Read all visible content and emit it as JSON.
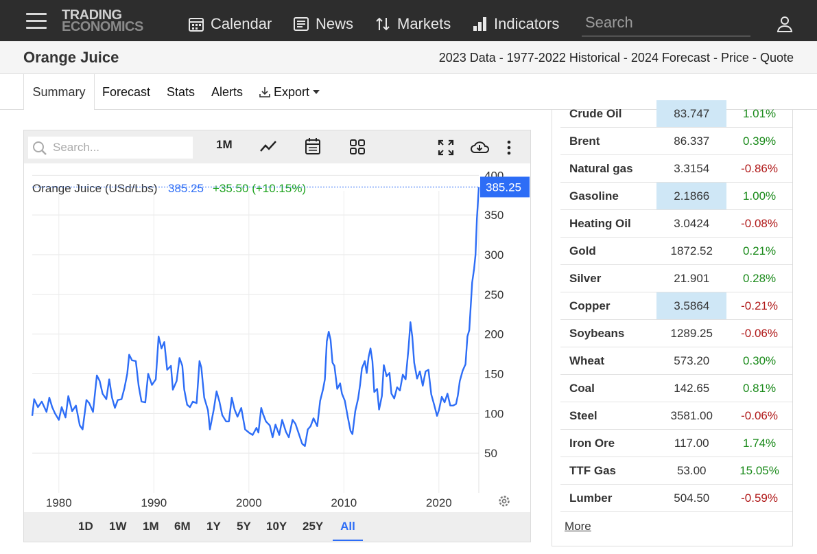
{
  "brand": {
    "line1": "TRADING",
    "line2": "ECONOMICS"
  },
  "nav": {
    "calendar": "Calendar",
    "news": "News",
    "markets": "Markets",
    "indicators": "Indicators",
    "search_placeholder": "Search"
  },
  "page": {
    "title": "Orange Juice",
    "crumbs": [
      {
        "label": "2023 Data"
      },
      {
        "label": "1977-2022 Historical"
      },
      {
        "label": "2024 Forecast"
      },
      {
        "label": "Price"
      },
      {
        "label": "Quote"
      }
    ],
    "crumb_separator": " - "
  },
  "tabs": {
    "summary": "Summary",
    "forecast": "Forecast",
    "stats": "Stats",
    "alerts": "Alerts",
    "export": "Export"
  },
  "chart_toolbar": {
    "search_placeholder": "Search...",
    "range_label": "1M"
  },
  "chart_data": {
    "type": "line",
    "title": "Orange Juice (USd/Lbs)",
    "last_value": "385.25",
    "change": "+35.50 (+10.15%)",
    "price_tag": "385.25",
    "xlabel": "",
    "ylabel": "",
    "x_ticks": [
      1980,
      1990,
      2000,
      2010,
      2020
    ],
    "y_ticks": [
      50,
      100,
      150,
      200,
      250,
      300,
      350,
      400
    ],
    "xlim": [
      1977.2,
      2024.2
    ],
    "ylim": [
      0,
      415
    ],
    "grid": true,
    "series": [
      {
        "color": "#2d6df6",
        "points": [
          [
            1977.2,
            97
          ],
          [
            1977.4,
            118
          ],
          [
            1977.8,
            108
          ],
          [
            1978.2,
            115
          ],
          [
            1978.7,
            102
          ],
          [
            1979.0,
            120
          ],
          [
            1979.3,
            108
          ],
          [
            1979.6,
            100
          ],
          [
            1980.0,
            92
          ],
          [
            1980.3,
            108
          ],
          [
            1980.7,
            95
          ],
          [
            1981.0,
            122
          ],
          [
            1981.4,
            103
          ],
          [
            1981.8,
            110
          ],
          [
            1982.2,
            85
          ],
          [
            1982.5,
            80
          ],
          [
            1982.9,
            117
          ],
          [
            1983.2,
            113
          ],
          [
            1983.6,
            102
          ],
          [
            1984.0,
            148
          ],
          [
            1984.3,
            141
          ],
          [
            1984.6,
            125
          ],
          [
            1985.0,
            118
          ],
          [
            1985.3,
            143
          ],
          [
            1985.6,
            120
          ],
          [
            1985.9,
            107
          ],
          [
            1986.2,
            117
          ],
          [
            1986.6,
            118
          ],
          [
            1986.9,
            132
          ],
          [
            1987.2,
            150
          ],
          [
            1987.4,
            174
          ],
          [
            1987.7,
            167
          ],
          [
            1988.1,
            166
          ],
          [
            1988.4,
            135
          ],
          [
            1988.7,
            115
          ],
          [
            1989.1,
            114
          ],
          [
            1989.4,
            150
          ],
          [
            1989.8,
            136
          ],
          [
            1990.2,
            143
          ],
          [
            1990.5,
            197
          ],
          [
            1990.8,
            182
          ],
          [
            1991.1,
            190
          ],
          [
            1991.4,
            155
          ],
          [
            1991.8,
            160
          ],
          [
            1992.0,
            130
          ],
          [
            1992.4,
            141
          ],
          [
            1992.7,
            170
          ],
          [
            1993.0,
            160
          ],
          [
            1993.2,
            130
          ],
          [
            1993.5,
            111
          ],
          [
            1993.8,
            108
          ],
          [
            1994.1,
            115
          ],
          [
            1994.5,
            113
          ],
          [
            1994.8,
            166
          ],
          [
            1995.0,
            158
          ],
          [
            1995.3,
            120
          ],
          [
            1995.7,
            104
          ],
          [
            1995.9,
            80
          ],
          [
            1996.3,
            105
          ],
          [
            1996.6,
            128
          ],
          [
            1996.9,
            115
          ],
          [
            1997.2,
            98
          ],
          [
            1997.6,
            90
          ],
          [
            1997.9,
            90
          ],
          [
            1998.2,
            120
          ],
          [
            1998.5,
            105
          ],
          [
            1998.8,
            96
          ],
          [
            1999.2,
            107
          ],
          [
            1999.6,
            80
          ],
          [
            2000.0,
            76
          ],
          [
            2000.4,
            73
          ],
          [
            2000.8,
            82
          ],
          [
            2001.0,
            76
          ],
          [
            2001.3,
            107
          ],
          [
            2001.5,
            99
          ],
          [
            2001.8,
            90
          ],
          [
            2002.2,
            85
          ],
          [
            2002.5,
            70
          ],
          [
            2002.8,
            86
          ],
          [
            2003.2,
            73
          ],
          [
            2003.5,
            92
          ],
          [
            2003.9,
            77
          ],
          [
            2004.2,
            70
          ],
          [
            2004.6,
            92
          ],
          [
            2004.9,
            87
          ],
          [
            2005.3,
            73
          ],
          [
            2005.6,
            62
          ],
          [
            2005.9,
            59
          ],
          [
            2006.2,
            80
          ],
          [
            2006.5,
            84
          ],
          [
            2006.8,
            94
          ],
          [
            2007.2,
            84
          ],
          [
            2007.5,
            116
          ],
          [
            2007.8,
            130
          ],
          [
            2008.0,
            143
          ],
          [
            2008.2,
            191
          ],
          [
            2008.4,
            203
          ],
          [
            2008.6,
            193
          ],
          [
            2008.8,
            164
          ],
          [
            2009.0,
            160
          ],
          [
            2009.3,
            131
          ],
          [
            2009.6,
            138
          ],
          [
            2009.8,
            125
          ],
          [
            2010.1,
            116
          ],
          [
            2010.4,
            96
          ],
          [
            2010.7,
            78
          ],
          [
            2010.9,
            74
          ],
          [
            2011.2,
            103
          ],
          [
            2011.5,
            119
          ],
          [
            2011.7,
            136
          ],
          [
            2011.9,
            157
          ],
          [
            2012.2,
            166
          ],
          [
            2012.4,
            151
          ],
          [
            2012.6,
            171
          ],
          [
            2012.8,
            182
          ],
          [
            2013.0,
            166
          ],
          [
            2013.2,
            127
          ],
          [
            2013.5,
            131
          ],
          [
            2013.7,
            105
          ],
          [
            2014.0,
            122
          ],
          [
            2014.2,
            161
          ],
          [
            2014.5,
            147
          ],
          [
            2014.8,
            151
          ],
          [
            2015.0,
            125
          ],
          [
            2015.3,
            119
          ],
          [
            2015.6,
            133
          ],
          [
            2015.9,
            129
          ],
          [
            2016.2,
            149
          ],
          [
            2016.5,
            143
          ],
          [
            2016.8,
            182
          ],
          [
            2017.0,
            215
          ],
          [
            2017.2,
            197
          ],
          [
            2017.4,
            164
          ],
          [
            2017.7,
            144
          ],
          [
            2018.0,
            153
          ],
          [
            2018.3,
            135
          ],
          [
            2018.6,
            153
          ],
          [
            2018.9,
            155
          ],
          [
            2019.2,
            124
          ],
          [
            2019.5,
            111
          ],
          [
            2019.8,
            97
          ],
          [
            2020.0,
            104
          ],
          [
            2020.3,
            121
          ],
          [
            2020.6,
            114
          ],
          [
            2020.9,
            125
          ],
          [
            2021.2,
            110
          ],
          [
            2021.5,
            110
          ],
          [
            2021.8,
            112
          ],
          [
            2022.0,
            123
          ],
          [
            2022.2,
            141
          ],
          [
            2022.5,
            154
          ],
          [
            2022.8,
            162
          ],
          [
            2023.0,
            197
          ],
          [
            2023.2,
            205
          ],
          [
            2023.5,
            265
          ],
          [
            2023.7,
            282
          ],
          [
            2023.85,
            300
          ],
          [
            2024.0,
            345
          ],
          [
            2024.2,
            385.25
          ]
        ]
      }
    ]
  },
  "periods": {
    "p1d": "1D",
    "p1w": "1W",
    "p1m": "1M",
    "p6m": "6M",
    "p1y": "1Y",
    "p5y": "5Y",
    "p10y": "10Y",
    "p25y": "25Y",
    "all": "All"
  },
  "markets": [
    {
      "name": "Crude Oil",
      "value": "83.747",
      "change": "1.01%",
      "highlight": true,
      "direction": "up"
    },
    {
      "name": "Brent",
      "value": "86.337",
      "change": "0.39%",
      "highlight": false,
      "direction": "up"
    },
    {
      "name": "Natural gas",
      "value": "3.3154",
      "change": "-0.86%",
      "highlight": false,
      "direction": "down"
    },
    {
      "name": "Gasoline",
      "value": "2.1866",
      "change": "1.00%",
      "highlight": true,
      "direction": "up"
    },
    {
      "name": "Heating Oil",
      "value": "3.0424",
      "change": "-0.08%",
      "highlight": false,
      "direction": "down"
    },
    {
      "name": "Gold",
      "value": "1872.52",
      "change": "0.21%",
      "highlight": false,
      "direction": "up"
    },
    {
      "name": "Silver",
      "value": "21.901",
      "change": "0.28%",
      "highlight": false,
      "direction": "up"
    },
    {
      "name": "Copper",
      "value": "3.5864",
      "change": "-0.21%",
      "highlight": true,
      "direction": "down"
    },
    {
      "name": "Soybeans",
      "value": "1289.25",
      "change": "-0.06%",
      "highlight": false,
      "direction": "down"
    },
    {
      "name": "Wheat",
      "value": "573.20",
      "change": "0.30%",
      "highlight": false,
      "direction": "up"
    },
    {
      "name": "Coal",
      "value": "142.65",
      "change": "0.81%",
      "highlight": false,
      "direction": "up"
    },
    {
      "name": "Steel",
      "value": "3581.00",
      "change": "-0.06%",
      "highlight": false,
      "direction": "down"
    },
    {
      "name": "Iron Ore",
      "value": "117.00",
      "change": "1.74%",
      "highlight": false,
      "direction": "up"
    },
    {
      "name": "TTF Gas",
      "value": "53.00",
      "change": "15.05%",
      "highlight": false,
      "direction": "up"
    },
    {
      "name": "Lumber",
      "value": "504.50",
      "change": "-0.59%",
      "highlight": false,
      "direction": "down"
    }
  ],
  "more_label": "More",
  "colors": {
    "accent": "#2d6df6",
    "positive": "#1a8a1a",
    "negative": "#b01818",
    "highlight": "#cfe7f6",
    "nav_bg": "#2d2d2d"
  }
}
